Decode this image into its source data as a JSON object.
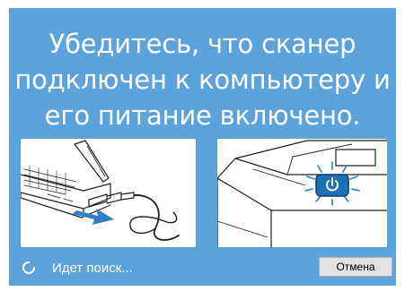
{
  "dialog": {
    "headline": "Убедитесь, что сканер\nподключен к компьютеру и\nего питание включено."
  },
  "illustrations": {
    "left": "laptop-usb-connection",
    "right": "scanner-power-button"
  },
  "status": {
    "text": "Идет поиск...",
    "icon": "loading-spinner-icon"
  },
  "actions": {
    "cancel_label": "Отмена"
  },
  "colors": {
    "background": "#5aa3dc",
    "arrow": "#2f7fc6",
    "power_button": "#1f6fb8"
  }
}
